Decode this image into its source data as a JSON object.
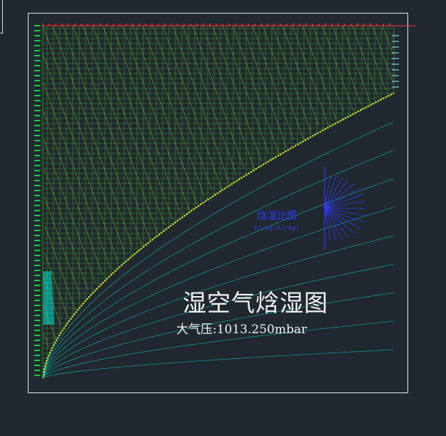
{
  "chart": {
    "title": "湿空气焓湿图",
    "pressure_label": "大气压:1013.250mbar"
  },
  "protractor": {
    "title": "焓湿比图",
    "unit": "kJ/kg(kJ/kg)"
  },
  "colors": {
    "background": "#212830",
    "frame": "#e8e8e8",
    "grid_green": "#1a7a1a",
    "enthalpy_lines": "#c8d800",
    "rh_curves": "#00e0d0",
    "saturation": "#ffee00",
    "axis_labels": "#00ff40",
    "top_labels": "#ff3030",
    "protractor": "#2d3cff"
  }
}
